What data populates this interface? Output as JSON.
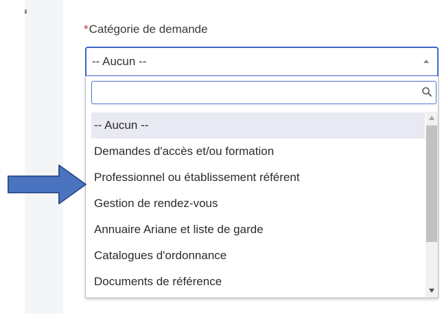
{
  "field": {
    "required_marker": "*",
    "label": "Catégorie de demande",
    "selected_value": "-- Aucun --"
  },
  "search": {
    "placeholder": "",
    "value": ""
  },
  "options": [
    "-- Aucun --",
    "Demandes d'accès et/ou formation",
    "Professionnel ou établissement référent",
    "Gestion de rendez-vous",
    "Annuaire Ariane et liste de garde",
    "Catalogues d'ordonnance",
    "Documents de référence"
  ],
  "selected_index": 0,
  "colors": {
    "focus_border": "#3b63c9",
    "required": "#d0262c",
    "highlight": "#e8e9f3",
    "annotation_arrow": "#4a74c0"
  },
  "icons": {
    "search": "search-icon",
    "caret": "chevron-up-icon",
    "annotation": "arrow-right-icon"
  }
}
